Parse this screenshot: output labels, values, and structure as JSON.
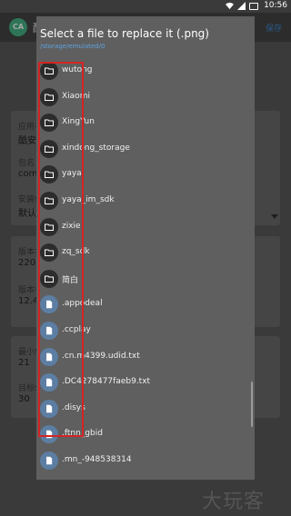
{
  "status_bar": {
    "time": "10:56",
    "icons": [
      "wifi-icon",
      "signal-icon",
      "battery-icon"
    ]
  },
  "background_app": {
    "header_title": "酷",
    "header_link": "保存",
    "fields": [
      {
        "label": "应用名",
        "value": "酷安"
      },
      {
        "label": "包名",
        "value": "com.c"
      },
      {
        "label": "安装位置",
        "value": "默认"
      },
      {
        "label": "版本名",
        "value": "2208"
      },
      {
        "label": "版本号",
        "value": "12.4."
      },
      {
        "label": "最小SDK",
        "value": "21"
      },
      {
        "label": "目标SDK",
        "value": "30"
      }
    ]
  },
  "dialog": {
    "title": "Select a file to replace it (.png)",
    "path": "/storage/emulated/0",
    "items": [
      {
        "name": "wutong",
        "type": "folder"
      },
      {
        "name": "Xiaomi",
        "type": "folder"
      },
      {
        "name": "XingYun",
        "type": "folder"
      },
      {
        "name": "xindong_storage",
        "type": "folder"
      },
      {
        "name": "yaya",
        "type": "folder"
      },
      {
        "name": "yaya_im_sdk",
        "type": "folder"
      },
      {
        "name": "zixie",
        "type": "folder"
      },
      {
        "name": "zq_sdk",
        "type": "folder"
      },
      {
        "name": "简白",
        "type": "folder"
      },
      {
        "name": ".appodeal",
        "type": "file"
      },
      {
        "name": ".ccplay",
        "type": "file"
      },
      {
        "name": ".cn.m4399.udid.txt",
        "type": "file"
      },
      {
        "name": ".DC4278477faeb9.txt",
        "type": "file"
      },
      {
        "name": ".disys",
        "type": "file"
      },
      {
        "name": ".ftnn_gbid",
        "type": "file"
      },
      {
        "name": ".mn_-948538314",
        "type": "file"
      }
    ]
  },
  "watermark": "大玩客",
  "colors": {
    "dialog_bg": "#5f5f5f",
    "path_blue": "#5ea3e0",
    "folder_icon_bg": "#2c2c2c",
    "file_icon_bg": "#5c7ea3",
    "annotation_red": "#d42424"
  }
}
